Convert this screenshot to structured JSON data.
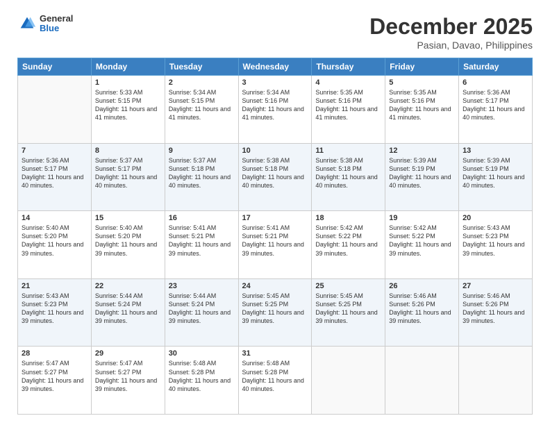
{
  "header": {
    "logo": {
      "general": "General",
      "blue": "Blue"
    },
    "title": "December 2025",
    "subtitle": "Pasian, Davao, Philippines"
  },
  "calendar": {
    "days_of_week": [
      "Sunday",
      "Monday",
      "Tuesday",
      "Wednesday",
      "Thursday",
      "Friday",
      "Saturday"
    ],
    "weeks": [
      [
        {
          "day": "",
          "empty": true
        },
        {
          "day": "1",
          "sunrise": "5:33 AM",
          "sunset": "5:15 PM",
          "daylight": "11 hours and 41 minutes."
        },
        {
          "day": "2",
          "sunrise": "5:34 AM",
          "sunset": "5:15 PM",
          "daylight": "11 hours and 41 minutes."
        },
        {
          "day": "3",
          "sunrise": "5:34 AM",
          "sunset": "5:16 PM",
          "daylight": "11 hours and 41 minutes."
        },
        {
          "day": "4",
          "sunrise": "5:35 AM",
          "sunset": "5:16 PM",
          "daylight": "11 hours and 41 minutes."
        },
        {
          "day": "5",
          "sunrise": "5:35 AM",
          "sunset": "5:16 PM",
          "daylight": "11 hours and 41 minutes."
        },
        {
          "day": "6",
          "sunrise": "5:36 AM",
          "sunset": "5:17 PM",
          "daylight": "11 hours and 40 minutes."
        }
      ],
      [
        {
          "day": "7",
          "sunrise": "5:36 AM",
          "sunset": "5:17 PM",
          "daylight": "11 hours and 40 minutes."
        },
        {
          "day": "8",
          "sunrise": "5:37 AM",
          "sunset": "5:17 PM",
          "daylight": "11 hours and 40 minutes."
        },
        {
          "day": "9",
          "sunrise": "5:37 AM",
          "sunset": "5:18 PM",
          "daylight": "11 hours and 40 minutes."
        },
        {
          "day": "10",
          "sunrise": "5:38 AM",
          "sunset": "5:18 PM",
          "daylight": "11 hours and 40 minutes."
        },
        {
          "day": "11",
          "sunrise": "5:38 AM",
          "sunset": "5:18 PM",
          "daylight": "11 hours and 40 minutes."
        },
        {
          "day": "12",
          "sunrise": "5:39 AM",
          "sunset": "5:19 PM",
          "daylight": "11 hours and 40 minutes."
        },
        {
          "day": "13",
          "sunrise": "5:39 AM",
          "sunset": "5:19 PM",
          "daylight": "11 hours and 40 minutes."
        }
      ],
      [
        {
          "day": "14",
          "sunrise": "5:40 AM",
          "sunset": "5:20 PM",
          "daylight": "11 hours and 39 minutes."
        },
        {
          "day": "15",
          "sunrise": "5:40 AM",
          "sunset": "5:20 PM",
          "daylight": "11 hours and 39 minutes."
        },
        {
          "day": "16",
          "sunrise": "5:41 AM",
          "sunset": "5:21 PM",
          "daylight": "11 hours and 39 minutes."
        },
        {
          "day": "17",
          "sunrise": "5:41 AM",
          "sunset": "5:21 PM",
          "daylight": "11 hours and 39 minutes."
        },
        {
          "day": "18",
          "sunrise": "5:42 AM",
          "sunset": "5:22 PM",
          "daylight": "11 hours and 39 minutes."
        },
        {
          "day": "19",
          "sunrise": "5:42 AM",
          "sunset": "5:22 PM",
          "daylight": "11 hours and 39 minutes."
        },
        {
          "day": "20",
          "sunrise": "5:43 AM",
          "sunset": "5:23 PM",
          "daylight": "11 hours and 39 minutes."
        }
      ],
      [
        {
          "day": "21",
          "sunrise": "5:43 AM",
          "sunset": "5:23 PM",
          "daylight": "11 hours and 39 minutes."
        },
        {
          "day": "22",
          "sunrise": "5:44 AM",
          "sunset": "5:24 PM",
          "daylight": "11 hours and 39 minutes."
        },
        {
          "day": "23",
          "sunrise": "5:44 AM",
          "sunset": "5:24 PM",
          "daylight": "11 hours and 39 minutes."
        },
        {
          "day": "24",
          "sunrise": "5:45 AM",
          "sunset": "5:25 PM",
          "daylight": "11 hours and 39 minutes."
        },
        {
          "day": "25",
          "sunrise": "5:45 AM",
          "sunset": "5:25 PM",
          "daylight": "11 hours and 39 minutes."
        },
        {
          "day": "26",
          "sunrise": "5:46 AM",
          "sunset": "5:26 PM",
          "daylight": "11 hours and 39 minutes."
        },
        {
          "day": "27",
          "sunrise": "5:46 AM",
          "sunset": "5:26 PM",
          "daylight": "11 hours and 39 minutes."
        }
      ],
      [
        {
          "day": "28",
          "sunrise": "5:47 AM",
          "sunset": "5:27 PM",
          "daylight": "11 hours and 39 minutes."
        },
        {
          "day": "29",
          "sunrise": "5:47 AM",
          "sunset": "5:27 PM",
          "daylight": "11 hours and 39 minutes."
        },
        {
          "day": "30",
          "sunrise": "5:48 AM",
          "sunset": "5:28 PM",
          "daylight": "11 hours and 40 minutes."
        },
        {
          "day": "31",
          "sunrise": "5:48 AM",
          "sunset": "5:28 PM",
          "daylight": "11 hours and 40 minutes."
        },
        {
          "day": "",
          "empty": true
        },
        {
          "day": "",
          "empty": true
        },
        {
          "day": "",
          "empty": true
        }
      ]
    ]
  }
}
